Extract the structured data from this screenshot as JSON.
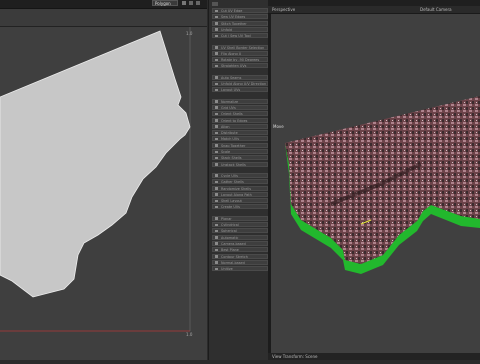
{
  "uv_editor": {
    "menu": [
      "Selection",
      "Select",
      "Textures"
    ],
    "dropdown": "Polygon",
    "tick_top": "1.0",
    "tick_bottom": "1.0"
  },
  "tool_panel": {
    "buttons": [
      "Cut UV Edge",
      "Sew UV Edges",
      "Stitch Together",
      "Unfold",
      "Cut / Sew UV Tool",
      "UV Shell Border Selection",
      "Flip Along U",
      "Rotate by -90 Degrees",
      "Straighten UVs",
      "Auto Seams",
      "Unfold Along U/V Direction",
      "Layout UVs",
      "Normalize",
      "Grid UVs",
      "Orient Shells",
      "Orient to Edges",
      "Align",
      "Distribute",
      "Match UVs",
      "Snap Together",
      "Scale",
      "Stack Shells",
      "Unstack Shells",
      "Cycle UVs",
      "Gather Shells",
      "Randomize Shells",
      "Layout Along Path",
      "Shell Layout",
      "Create UVs",
      "Planar",
      "Cylindrical",
      "Spherical",
      "Automatic",
      "Camera-based",
      "Best Plane",
      "Contour Stretch",
      "Normal-based",
      "Unitize"
    ]
  },
  "viewport": {
    "menu": [
      "View",
      "Shading",
      "Lighting",
      "Show",
      "Renderer",
      "Panels"
    ],
    "panel_label": "Perspective",
    "camera_label": "Default Camera",
    "tool_label": "Move",
    "status_label": "View Transform: Scene"
  },
  "colors": {
    "uv_shell_fill": "#c7c7c7",
    "uv_boundary_line": "#b33a3a",
    "terrain_side": "#22b82d",
    "terrain_top": "#7a4c52"
  }
}
